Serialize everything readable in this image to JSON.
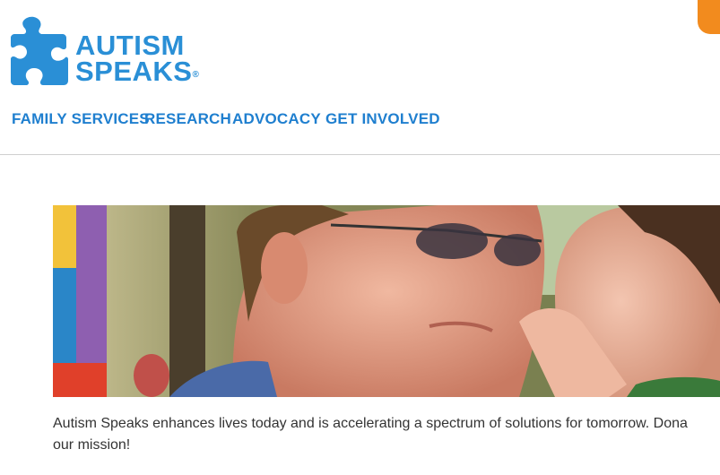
{
  "header": {
    "logo_line1": "AUTISM",
    "logo_line2": "SPEAKS",
    "logo_reg": "®",
    "logo_icon": "puzzle-piece-icon",
    "brand_color": "#2a8fd6",
    "accent_color": "#f28b1e"
  },
  "nav": {
    "items": [
      {
        "label": "FAMILY SERVICES"
      },
      {
        "label": "RESEARCH"
      },
      {
        "label": "ADVOCACY"
      },
      {
        "label": "GET INVOLVED"
      }
    ]
  },
  "mission": {
    "line1": "Autism Speaks enhances lives today and is accelerating a spectrum of solutions for tomorrow. Dona",
    "line2": "our mission!"
  }
}
